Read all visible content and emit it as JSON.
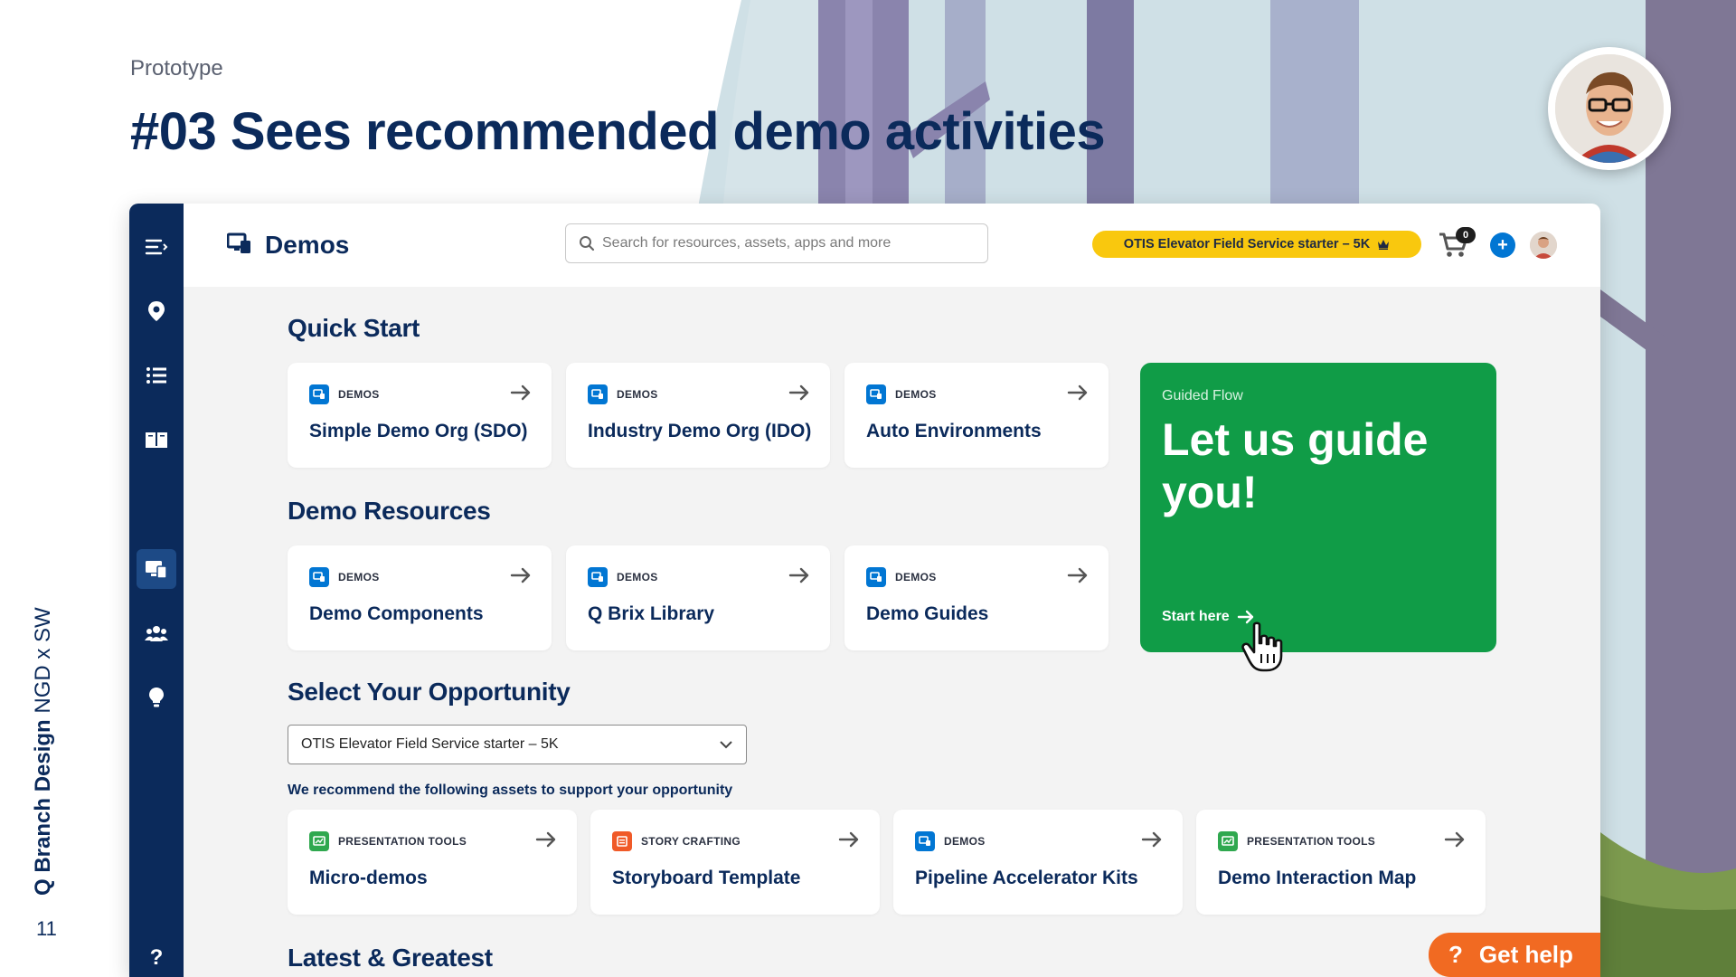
{
  "slide": {
    "label": "Prototype",
    "title": "#03 Sees recommended demo activities",
    "brand_bold": "Q Branch Design",
    "brand_rest": " NGD x SW",
    "page_number": "11"
  },
  "app": {
    "title": "Demos",
    "search": {
      "placeholder": "Search for resources, assets, apps and more"
    },
    "opportunity_pill": "OTIS Elevator Field Service starter – 5K",
    "cart_count": "0",
    "sidebar_icons": [
      "menu-icon",
      "location-pin-icon",
      "list-icon",
      "book-icon",
      "demos-icon",
      "people-icon",
      "lightbulb-icon",
      "help-icon"
    ],
    "help_label": "?"
  },
  "quick_start": {
    "heading": "Quick Start",
    "cards": [
      {
        "tag": "DEMOS",
        "title": "Simple Demo Org (SDO)"
      },
      {
        "tag": "DEMOS",
        "title": "Industry Demo Org (IDO)"
      },
      {
        "tag": "DEMOS",
        "title": "Auto Environments"
      }
    ]
  },
  "demo_resources": {
    "heading": "Demo Resources",
    "cards": [
      {
        "tag": "DEMOS",
        "title": "Demo Components"
      },
      {
        "tag": "DEMOS",
        "title": "Q Brix Library"
      },
      {
        "tag": "DEMOS",
        "title": "Demo Guides"
      }
    ]
  },
  "guided_flow": {
    "label": "Guided Flow",
    "title": "Let us guide you!",
    "cta": "Start here"
  },
  "opportunity": {
    "heading": "Select Your Opportunity",
    "selected": "OTIS Elevator Field Service starter – 5K",
    "recommend_text": "We recommend the following assets to support your opportunity",
    "cards": [
      {
        "tag": "PRESENTATION TOOLS",
        "title": "Micro-demos",
        "color": "#2fa84f"
      },
      {
        "tag": "STORY CRAFTING",
        "title": "Storyboard Template",
        "color": "#f05a28"
      },
      {
        "tag": "DEMOS",
        "title": "Pipeline Accelerator Kits",
        "color": "#0176d3"
      },
      {
        "tag": "PRESENTATION TOOLS",
        "title": "Demo Interaction Map",
        "color": "#2fa84f"
      }
    ]
  },
  "latest": {
    "heading": "Latest & Greatest"
  },
  "get_help": {
    "icon": "?",
    "label": "Get help"
  },
  "colors": {
    "navy": "#0b2a5b",
    "green": "#109c47",
    "yellow": "#f9c80e",
    "orange": "#f16a22",
    "blue": "#0176d3"
  }
}
